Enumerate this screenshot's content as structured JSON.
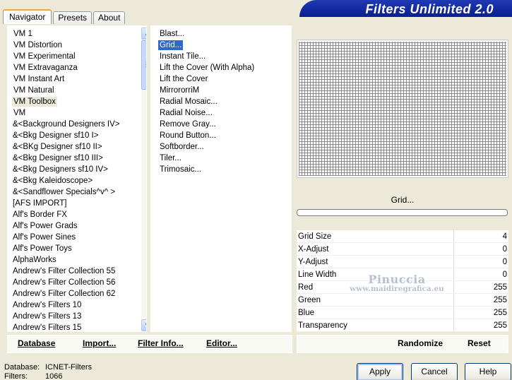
{
  "tabs": [
    {
      "label": "Navigator"
    },
    {
      "label": "Presets"
    },
    {
      "label": "About"
    }
  ],
  "app_title": "Filters Unlimited 2.0",
  "categories": [
    "VM 1",
    "VM Distortion",
    "VM Experimental",
    "VM Extravaganza",
    "VM Instant Art",
    "VM Natural",
    "VM Toolbox",
    "VM",
    "&<Background Designers IV>",
    "&<Bkg Designer sf10 I>",
    "&<BKg Designer sf10 II>",
    "&<Bkg Designer sf10 III>",
    "&<Bkg Designers sf10 IV>",
    "&<Bkg Kaleidoscope>",
    "&<Sandflower Specials^v^ >",
    "[AFS IMPORT]",
    "Alf's Border FX",
    "Alf's Power Grads",
    "Alf's Power Sines",
    "Alf's Power Toys",
    "AlphaWorks",
    "Andrew's Filter Collection 55",
    "Andrew's Filter Collection 56",
    "Andrew's Filter Collection 62",
    "Andrew's Filters 10",
    "Andrew's Filters 13",
    "Andrew's Filters 15"
  ],
  "selected_category": "VM Toolbox",
  "filters": [
    "Blast...",
    "Grid...",
    "Instant Tile...",
    "Lift the Cover (With Alpha)",
    "Lift the Cover",
    "MirrororriM",
    "Radial Mosaic...",
    "Radial Noise...",
    "Remove Gray...",
    "Round Button...",
    "Softborder...",
    "Tiler...",
    "Trimosaic..."
  ],
  "selected_filter": "Grid...",
  "preview_label": "Grid...",
  "params": [
    {
      "label": "Grid Size",
      "value": "4"
    },
    {
      "label": "X-Adjust",
      "value": "0"
    },
    {
      "label": "Y-Adjust",
      "value": "0"
    },
    {
      "label": "Line Width",
      "value": "0"
    },
    {
      "label": "Red",
      "value": "255"
    },
    {
      "label": "Green",
      "value": "255"
    },
    {
      "label": "Blue",
      "value": "255"
    },
    {
      "label": "Transparency",
      "value": "255"
    }
  ],
  "watermark": {
    "name": "Pinuccia",
    "url": "www.maidiregrafica.eu"
  },
  "left_buttons": {
    "database": "Database",
    "import": "Import...",
    "filter_info": "Filter Info...",
    "editor": "Editor..."
  },
  "right_buttons": {
    "randomize": "Randomize",
    "reset": "Reset"
  },
  "footer": {
    "database_label": "Database:",
    "database_value": "ICNET-Filters",
    "filters_label": "Filters:",
    "filters_value": "1066"
  },
  "dialog_buttons": {
    "apply": "Apply",
    "cancel": "Cancel",
    "help": "Help"
  },
  "colors": {
    "accent": "#316ac5",
    "banner": "#0a1f8f",
    "tab_highlight": "#f1a73b",
    "background": "#ece9d8"
  }
}
